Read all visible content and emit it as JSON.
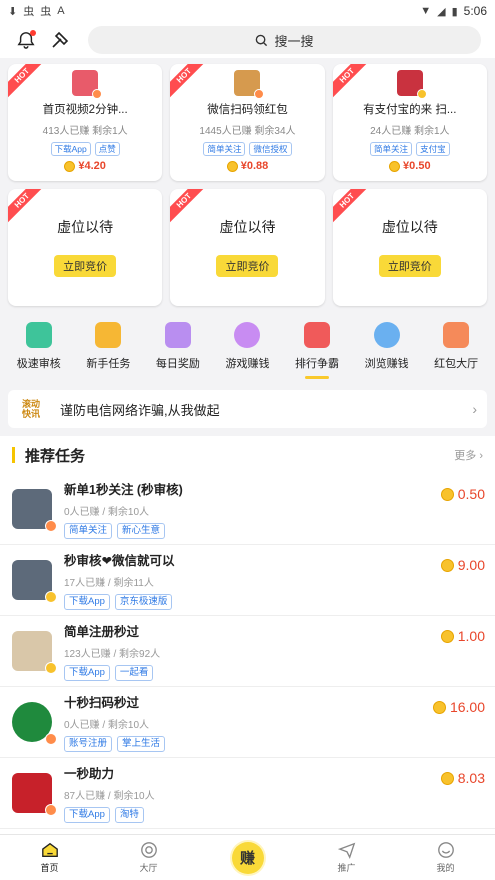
{
  "status": {
    "time": "5:06"
  },
  "search": {
    "placeholder": "搜一搜"
  },
  "hot_label": "HOT",
  "featured": [
    {
      "title": "首页视频2分钟...",
      "stats": "413人已赚  剩余1人",
      "tags": [
        "下载App",
        "点赞"
      ],
      "price": "¥4.20",
      "color": "#e85b6a"
    },
    {
      "title": "微信扫码领红包",
      "stats": "1445人已赚  剩余34人",
      "tags": [
        "简单关注",
        "微信授权"
      ],
      "price": "¥0.88",
      "color": "#d69a4e"
    },
    {
      "title": "有支付宝的来 扫...",
      "stats": "24人已赚  剩余1人",
      "tags": [
        "简单关注",
        "支付宝"
      ],
      "price": "¥0.50",
      "color": "#c9323f"
    }
  ],
  "placeholders": [
    {
      "title": "虚位以待",
      "button": "立即竞价"
    },
    {
      "title": "虚位以待",
      "button": "立即竞价"
    },
    {
      "title": "虚位以待",
      "button": "立即竞价"
    }
  ],
  "menu": [
    {
      "label": "极速审核",
      "color": "#3ec49a"
    },
    {
      "label": "新手任务",
      "color": "#f6b734"
    },
    {
      "label": "每日奖励",
      "color": "#b98ef0"
    },
    {
      "label": "游戏赚钱",
      "color": "#c88cf2"
    },
    {
      "label": "排行争霸",
      "color": "#f05a5a"
    },
    {
      "label": "浏览赚钱",
      "color": "#6ab0f0"
    },
    {
      "label": "红包大厅",
      "color": "#f58a5a"
    }
  ],
  "notice": {
    "logo_line1": "滚动",
    "logo_line2": "快讯",
    "text": "谨防电信网络诈骗,从我做起"
  },
  "section": {
    "title": "推荐任务",
    "more": "更多"
  },
  "tasks": [
    {
      "title": "新单1秒关注 (秒审核)",
      "meta": "0人已赚   /   剩余10人",
      "tags": [
        "简单关注",
        "新心生意"
      ],
      "price": "0.50",
      "color": "#5d6a7a"
    },
    {
      "title": "秒审核❤微信就可以",
      "meta": "17人已赚   /   剩余11人",
      "tags": [
        "下载App",
        "京东极速版"
      ],
      "price": "9.00",
      "color": "#5d6a7a"
    },
    {
      "title": "简单注册秒过",
      "meta": "123人已赚   /   剩余92人",
      "tags": [
        "下载App",
        "一起看"
      ],
      "price": "1.00",
      "color": "#d9c7a9"
    },
    {
      "title": "十秒扫码秒过",
      "meta": "0人已赚   /   剩余10人",
      "tags": [
        "账号注册",
        "掌上生活"
      ],
      "price": "16.00",
      "color": "#1f8a3d"
    },
    {
      "title": "一秒助力",
      "meta": "87人已赚   /   剩余10人",
      "tags": [
        "下载App",
        "淘特"
      ],
      "price": "8.03",
      "color": "#c7212a"
    }
  ],
  "bottomnav": [
    {
      "label": "首页"
    },
    {
      "label": "大厅"
    },
    {
      "label": "赚"
    },
    {
      "label": "推广"
    },
    {
      "label": "我的"
    }
  ]
}
